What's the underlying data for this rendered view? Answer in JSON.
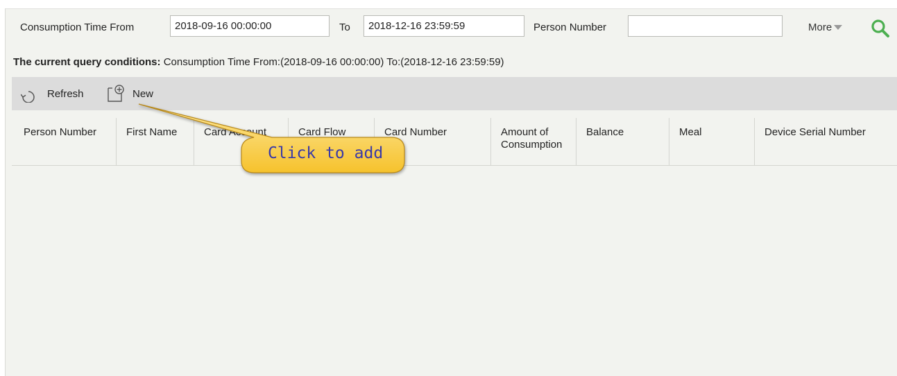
{
  "filter": {
    "time_from_label": "Consumption Time From",
    "time_from_value": "2018-09-16 00:00:00",
    "to_label": "To",
    "time_to_value": "2018-12-16 23:59:59",
    "person_number_label": "Person Number",
    "person_number_value": "",
    "more_label": "More"
  },
  "query": {
    "prefix": "The current query conditions:",
    "text": " Consumption Time From:(2018-09-16 00:00:00)  To:(2018-12-16 23:59:59)"
  },
  "toolbar": {
    "refresh_label": "Refresh",
    "new_label": "New"
  },
  "table": {
    "columns": [
      "Person Number",
      "First Name",
      "Card Account",
      "Card Flow",
      "Card Number",
      "Amount of Consumption",
      "Balance",
      "Meal",
      "Device Serial Number"
    ],
    "rows": []
  },
  "callout": {
    "text": "Click to add"
  },
  "colors": {
    "panel_bg": "#f2f3ef",
    "toolbar_bg": "#dcdcdc",
    "search_icon": "#4caf50",
    "callout_fill": "#fbd046",
    "callout_text": "#3a3aa8"
  },
  "icons": {
    "refresh": "refresh-icon",
    "new": "add-document-icon",
    "search": "search-icon",
    "more": "chevron-down-icon"
  }
}
